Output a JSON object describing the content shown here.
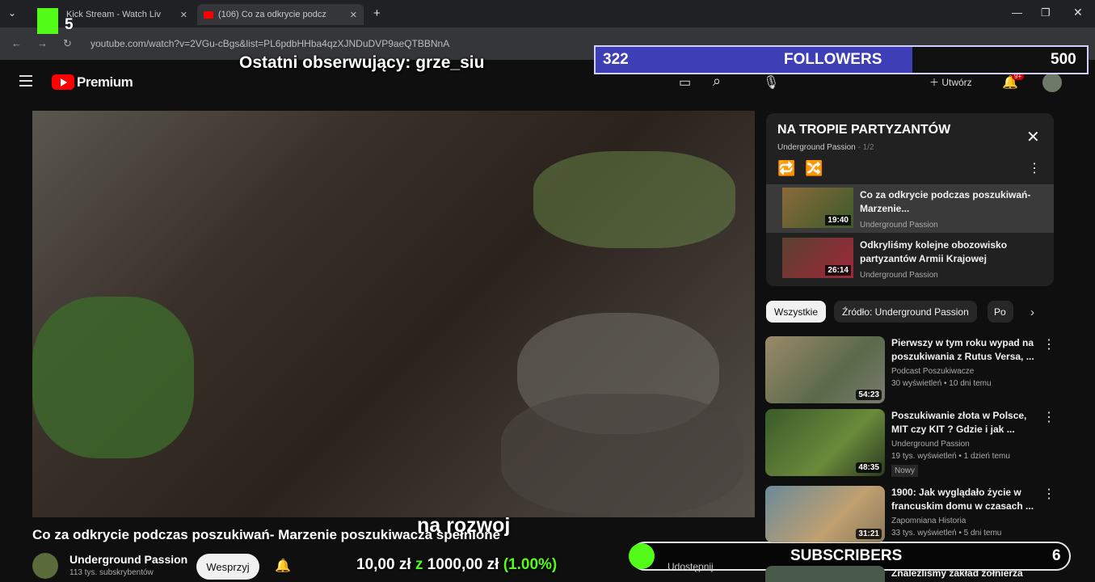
{
  "browser": {
    "tabs": [
      {
        "label": "Kick Stream - Watch Liv"
      },
      {
        "label": "(106) Co za odkrycie podcz"
      }
    ],
    "url": "youtube.com/watch?v=2VGu-cBgs&list=PL6pdbHHba4qzXJNDuDVP9aeQTBBNnA"
  },
  "overlay": {
    "last_follower": "Ostatni obserwujący: grze_siu",
    "followers_current": "322",
    "followers_label": "FOLLOWERS",
    "followers_goal": "500",
    "followers_progress": 0.644,
    "kick_number": "5",
    "donation_current": "10,00 zł",
    "donation_sep": "z",
    "donation_goal": "1000,00 zł",
    "donation_pct": "(1.00%)",
    "subscribers_label": "SUBSCRIBERS",
    "subscribers_count": "6",
    "subtitle": "na rozwoj"
  },
  "youtube": {
    "logo_text": "Premium",
    "create_label": "Utwórz",
    "notif_count": "9+",
    "video_title": "Co za odkrycie podczas poszukiwań- Marzenie poszukiwacza spełnione",
    "channel_name": "Underground Passion",
    "channel_subs": "113 tys. subskrybentów",
    "support_label": "Wesprzyj",
    "share_label": "Udostępnij"
  },
  "playlist": {
    "title": "NA TROPIE PARTYZANTÓW",
    "author": "Underground Passion",
    "author_suffix": "- 1/2",
    "items": [
      {
        "title": "Co za odkrycie podczas poszukiwań- Marzenie...",
        "channel": "Underground Passion",
        "duration": "19:40"
      },
      {
        "title": "Odkryliśmy kolejne obozowisko partyzantów Armii Krajowej",
        "channel": "Underground Passion",
        "duration": "26:14"
      }
    ]
  },
  "chips": [
    "Wszystkie",
    "Źródło: Underground Passion",
    "Po"
  ],
  "recommended": [
    {
      "title": "Pierwszy w tym roku wypad na poszukiwania z Rutus Versa, ...",
      "channel": "Podcast Poszukiwacze",
      "meta": "30 wyświetleń • 10 dni temu",
      "duration": "54:23"
    },
    {
      "title": "Poszukiwanie złota w Polsce, MIT czy KIT ? Gdzie i jak ...",
      "channel": "Underground Passion",
      "meta": "19 tys. wyświetleń • 1 dzień temu",
      "extra": "Nowy",
      "duration": "48:35"
    },
    {
      "title": "1900: Jak wyglądało życie w francuskim domu w czasach ...",
      "channel": "Zapomniana Historia",
      "meta": "33 tys. wyświetleń • 5 dni temu",
      "duration": "31:21"
    },
    {
      "title": "Znaleźliśmy zakład żołnierza Szkolnego - Zagadka ...",
      "channel": "",
      "meta": "",
      "duration": ""
    }
  ],
  "colors": {
    "followers_fill": "#3e3eb6",
    "kick_green": "#53fc18",
    "yt_red": "#ff0000"
  }
}
